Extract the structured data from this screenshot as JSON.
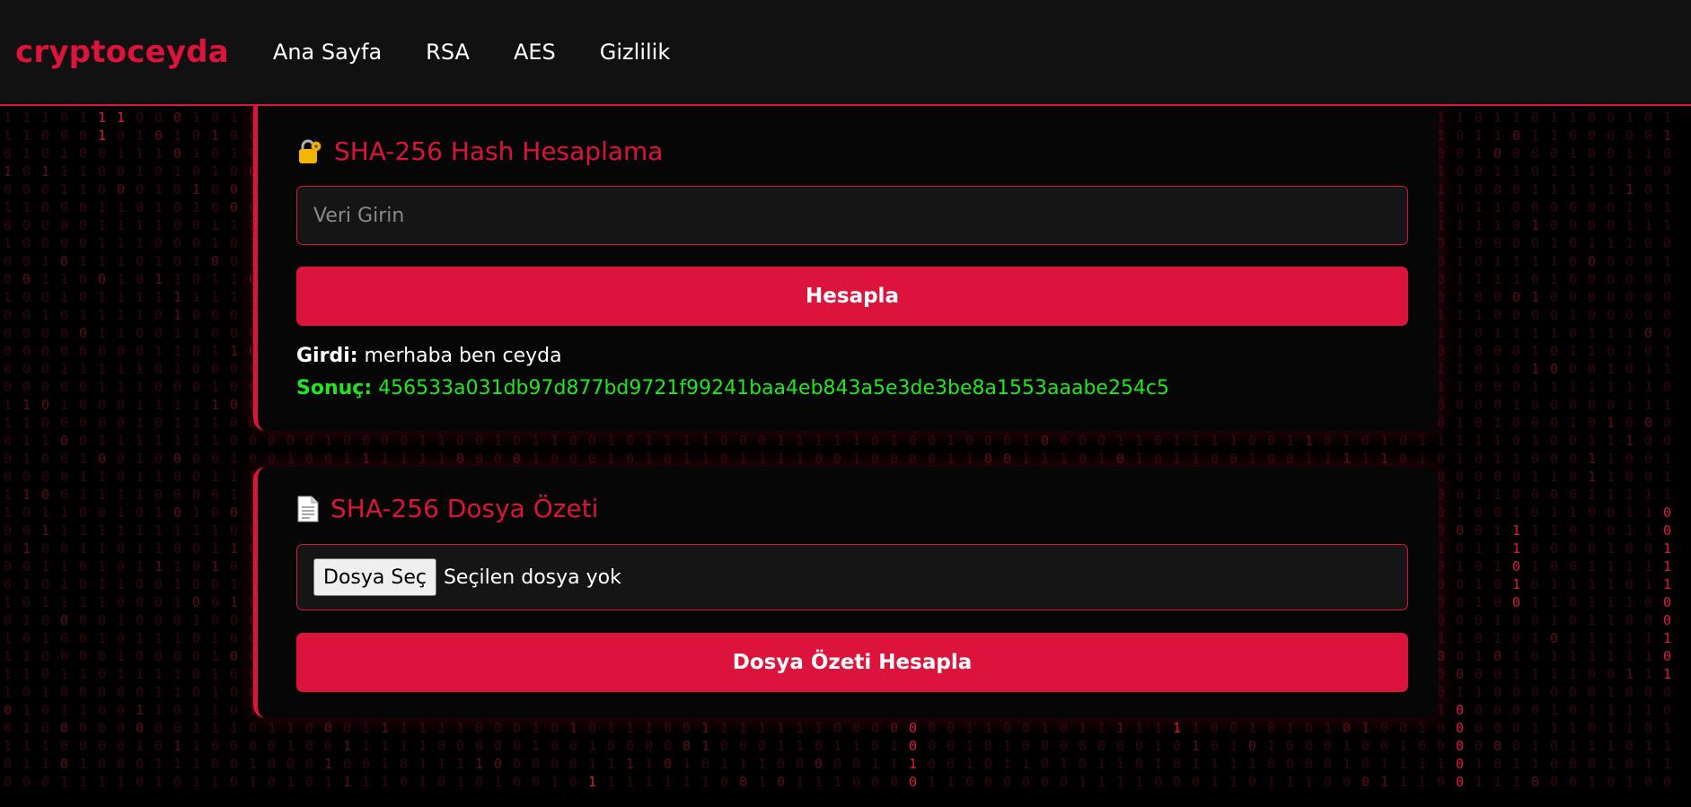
{
  "nav": {
    "brand": "cryptoceyda",
    "links": [
      "Ana Sayfa",
      "RSA",
      "AES",
      "Gizlilik"
    ]
  },
  "hash_card": {
    "icon": "locked-with-key-icon",
    "title": "SHA-256 Hash Hesaplama",
    "input_placeholder": "Veri Girin",
    "input_value": "",
    "button_label": "Hesapla",
    "input_label": "Girdi:",
    "input_text": "merhaba ben ceyda",
    "result_label": "Sonuç:",
    "result_text": "456533a031db97d877bd9721f99241baa4eb843a5e3de3be8a1553aaabe254c5"
  },
  "file_card": {
    "icon": "document-icon",
    "title": "SHA-256 Dosya Özeti",
    "file_button_label": "Dosya Seç",
    "file_status": "Seçilen dosya yok",
    "button_label": "Dosya Özeti Hesapla"
  },
  "colors": {
    "accent": "#dc143c",
    "result": "#22e622",
    "background": "#000000",
    "navbar": "#111111"
  }
}
